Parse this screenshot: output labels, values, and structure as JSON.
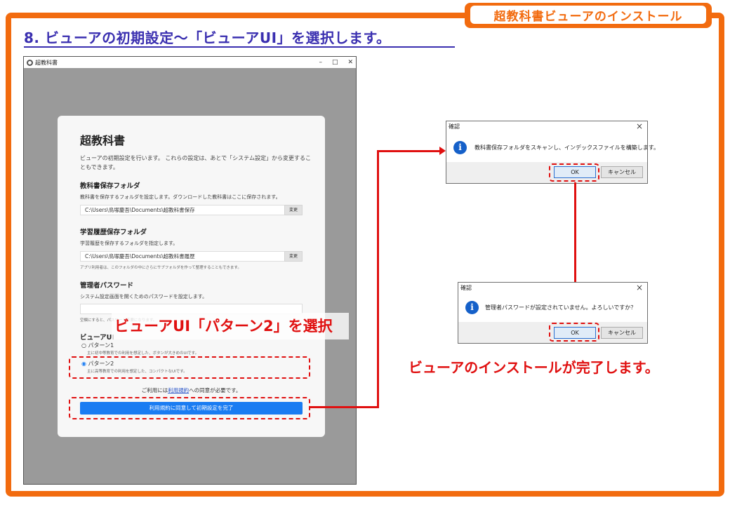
{
  "banner": {
    "title": "超教科書ビューアのインストール"
  },
  "heading": "8. ビューアの初期設定〜「ビューアUI」を選択します。",
  "app": {
    "window_title": "超教科書",
    "controls": {
      "minimize": "–",
      "maximize": "□",
      "close": "✕"
    },
    "card_title": "超教科書",
    "description": "ビューアの初期設定を行います。 これらの設定は、あとで「システム設定」から変更することもできます。",
    "textbook_folder": {
      "title": "教科書保存フォルダ",
      "desc": "教科書を保存するフォルダを設定します。ダウンロードした教科書はここに保存されます。",
      "value": "C:\\Users\\鳥塚慶吾\\Documents\\超教科書保存",
      "change_label": "変更"
    },
    "history_folder": {
      "title": "学習履歴保存フォルダ",
      "desc": "学習履歴を保存するフォルダを指定します。",
      "value": "C:\\Users\\鳥塚慶吾\\Documents\\超教科書履歴",
      "change_label": "変更",
      "note": "アプリ利用者は、このフォルダの中にさらにサブフォルダを作って整理することもできます。"
    },
    "admin_password": {
      "title": "管理者パスワード",
      "desc": "システム設定画面を開くためのパスワードを設定します。",
      "value": "",
      "note": "空欄にすると、パスワード不要になります。"
    },
    "viewer_ui": {
      "title": "ビューアUI",
      "option1": {
        "label": "パターン1",
        "desc": "主に初中等教育での利用を想定した、ボタンが大きめのUIです。",
        "checked": false
      },
      "option2": {
        "label": "パターン2",
        "desc": "主に高等教育での利用を想定した、コンパクトなUIです。",
        "checked": true
      }
    },
    "agree_prefix": "ご利用には",
    "agree_link": "利用規約",
    "agree_suffix": "への同意が必要です。",
    "finish_button": "利用規約に同意して初期設定を完了"
  },
  "callout": "ビューアUI「パターン2」を選択",
  "dialog1": {
    "title": "確認",
    "message": "教科書保存フォルダをスキャンし、インデックスファイルを構築します。",
    "ok": "OK",
    "cancel": "キャンセル"
  },
  "dialog2": {
    "title": "確認",
    "message": "管理者パスワードが設定されていません。よろしいですか？",
    "ok": "OK",
    "cancel": "キャンセル"
  },
  "complete_message": "ビューアのインストールが完了します。",
  "colors": {
    "frame": "#f26b0f",
    "heading": "#3a2fb0",
    "highlight": "#e01010",
    "primary_button": "#1a7cf2"
  },
  "icons": {
    "info": "info-icon",
    "close": "close-icon",
    "app": "app-logo-icon"
  }
}
